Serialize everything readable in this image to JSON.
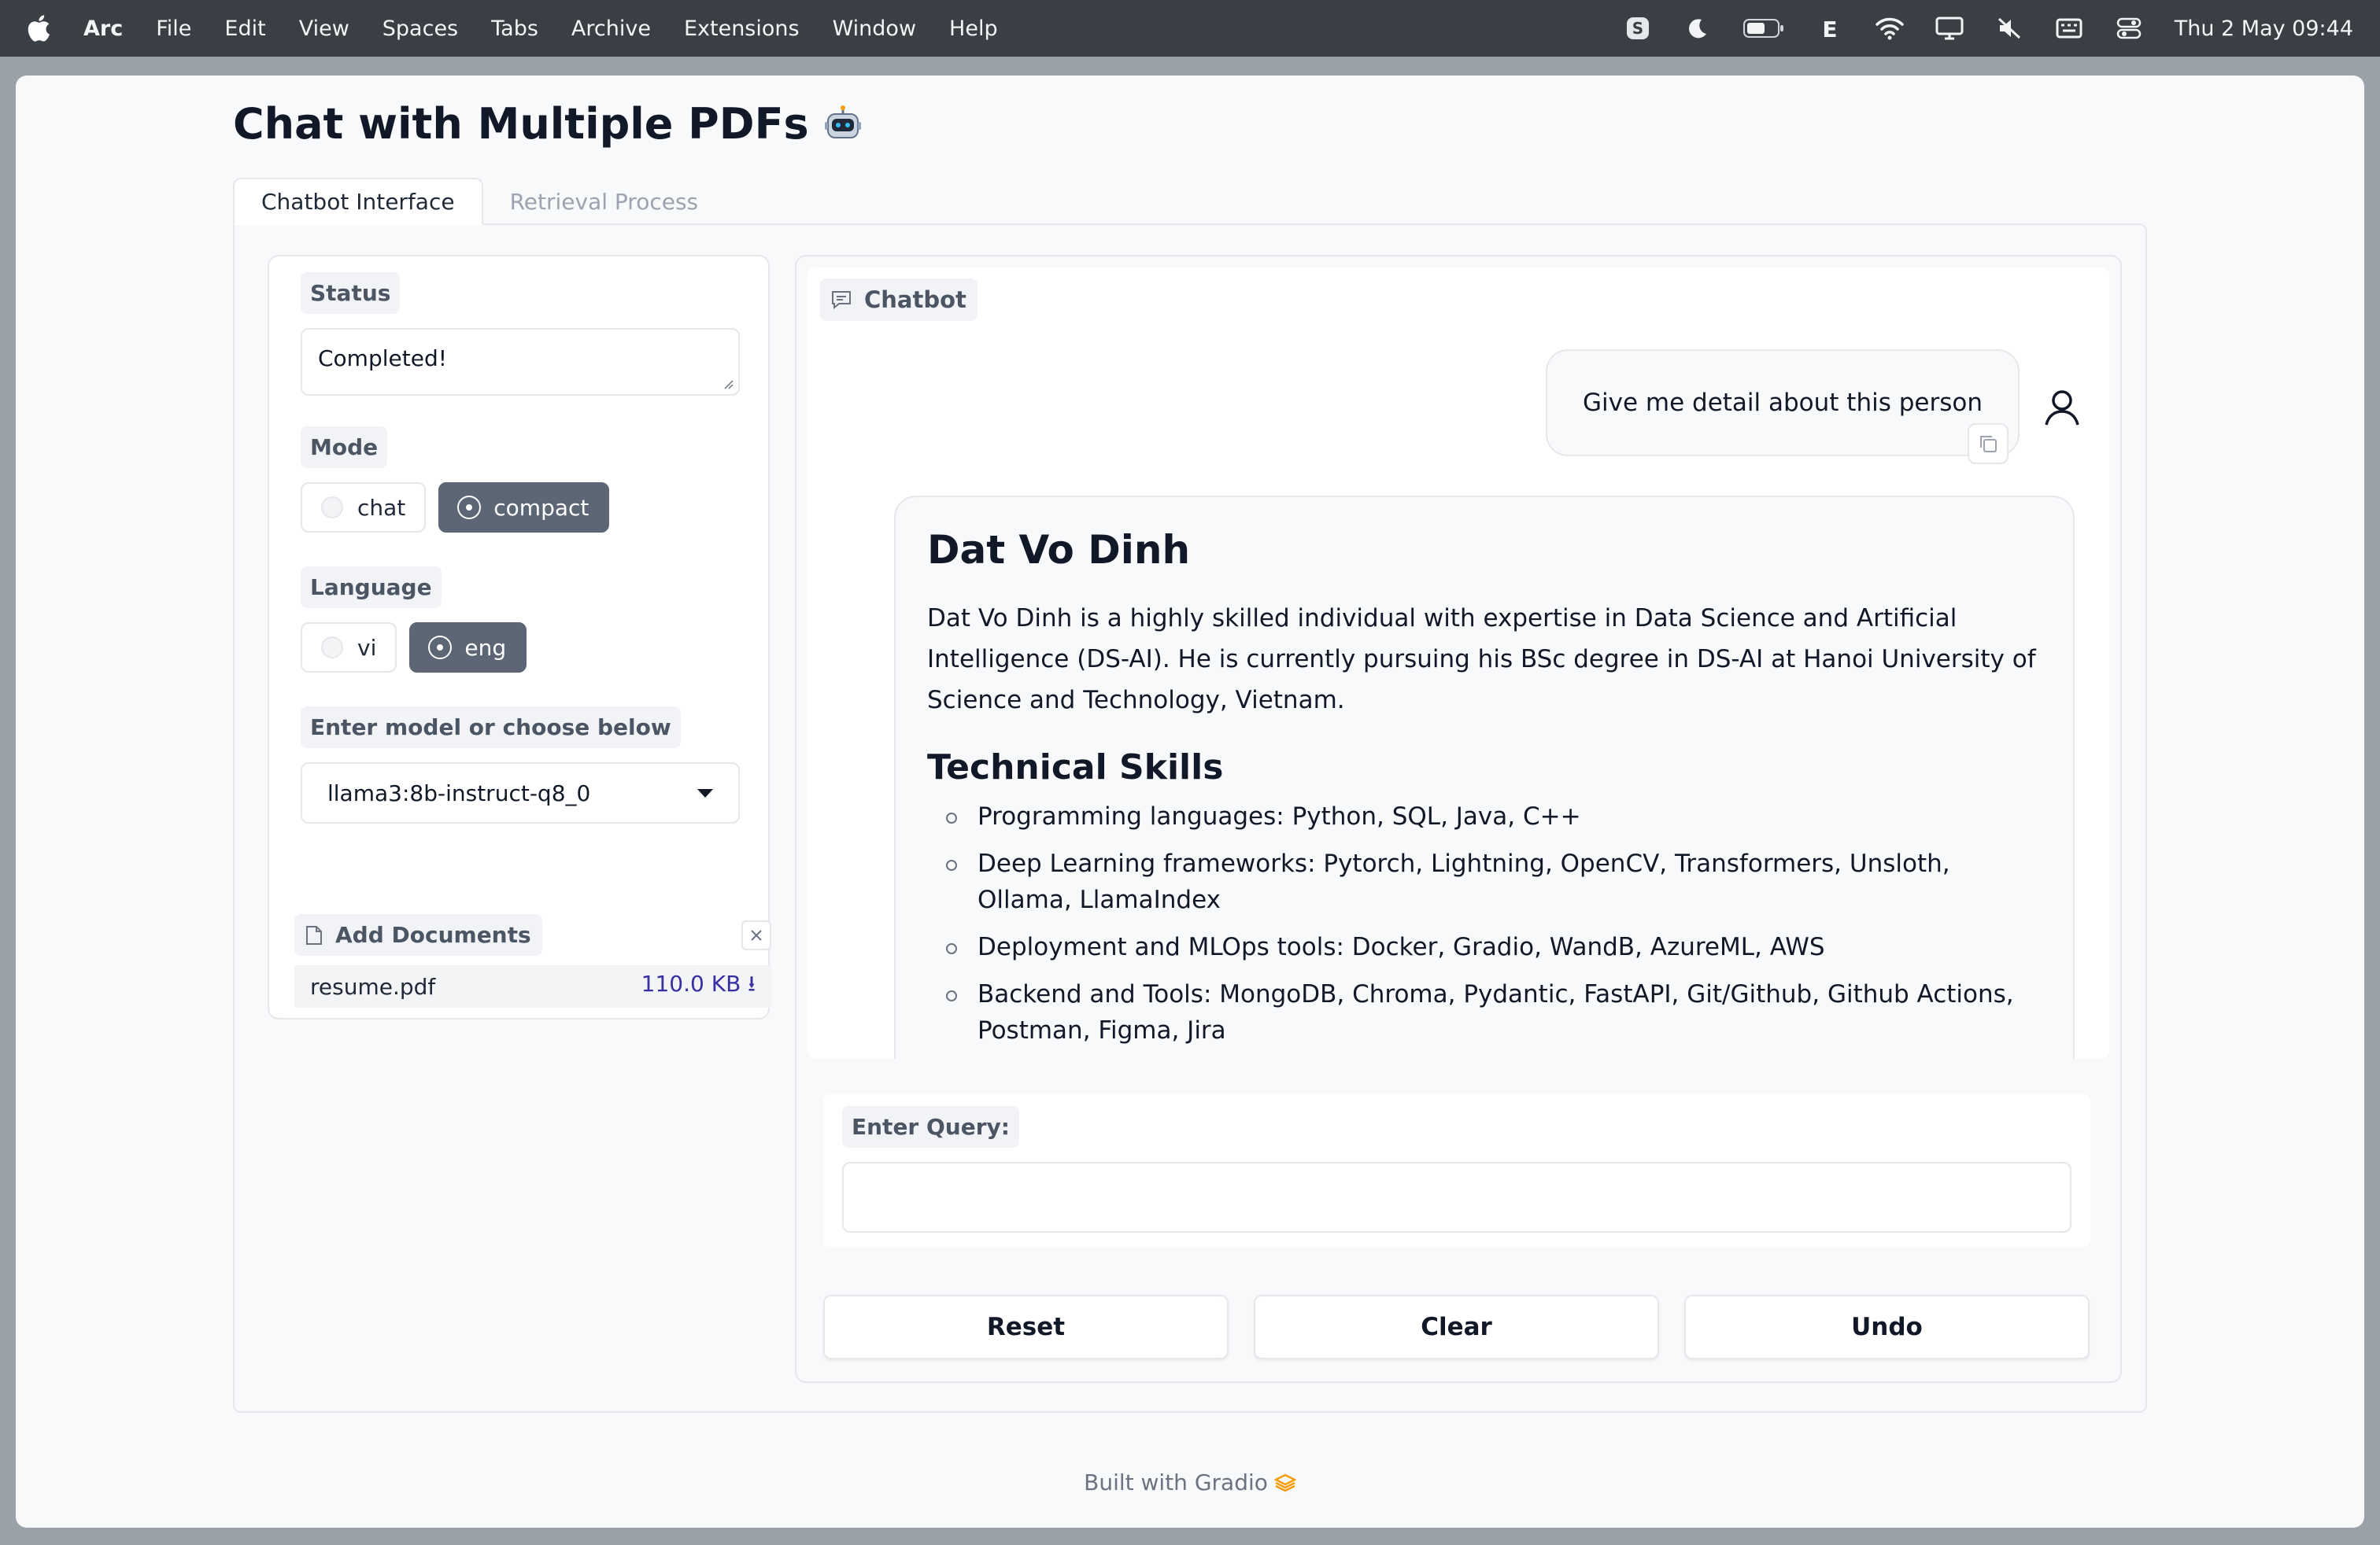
{
  "menubar": {
    "app": "Arc",
    "items": [
      "File",
      "Edit",
      "View",
      "Spaces",
      "Tabs",
      "Archive",
      "Extensions",
      "Window",
      "Help"
    ],
    "status_icons": [
      "skype-icon",
      "moon-icon",
      "battery-icon",
      "e-icon",
      "wifi-icon",
      "display-icon",
      "mute-icon",
      "keyboard-icon",
      "control-center-icon"
    ],
    "datetime": "Thu 2 May  09:44"
  },
  "page": {
    "title": "Chat with Multiple PDFs",
    "title_icon": "robot-icon",
    "tabs": [
      "Chatbot Interface",
      "Retrieval Process"
    ],
    "active_tab": 0
  },
  "left": {
    "status_label": "Status",
    "status_value": "Completed!",
    "mode_label": "Mode",
    "mode_options": [
      "chat",
      "compact"
    ],
    "mode_selected": "compact",
    "language_label": "Language",
    "language_options": [
      "vi",
      "eng"
    ],
    "language_selected": "eng",
    "model_label": "Enter model or choose below",
    "model_value": "llama3:8b-instruct-q8_0",
    "docs_label": "Add Documents",
    "file": {
      "name": "resume.pdf",
      "size": "110.0 KB ⭳"
    }
  },
  "chat": {
    "label": "Chatbot",
    "user_message": "Give me detail about this person",
    "bot": {
      "heading": "Dat Vo Dinh",
      "intro": "Dat Vo Dinh is a highly skilled individual with expertise in Data Science and Artificial Intelligence (DS-AI). He is currently pursuing his BSc degree in DS-AI at Hanoi University of Science and Technology, Vietnam.",
      "skills_heading": "Technical Skills",
      "skills": [
        "Programming languages: Python, SQL, Java, C++",
        "Deep Learning frameworks: Pytorch, Lightning, OpenCV, Transformers, Unsloth, Ollama, LlamaIndex",
        "Deployment and MLOps tools: Docker, Gradio, WandB, AzureML, AWS",
        "Backend and Tools: MongoDB, Chroma, Pydantic, FastAPI, Git/Github, Github Actions, Postman, Figma, Jira"
      ]
    },
    "query_label": "Enter Query:",
    "query_value": "",
    "buttons": {
      "reset": "Reset",
      "clear": "Clear",
      "undo": "Undo"
    }
  },
  "footer": {
    "text": "Built with Gradio",
    "icon": "gradio-logo-icon"
  },
  "colors": {
    "selected_radio": "#5d6675",
    "link": "#3730a3",
    "menubar": "#3a3f45"
  }
}
